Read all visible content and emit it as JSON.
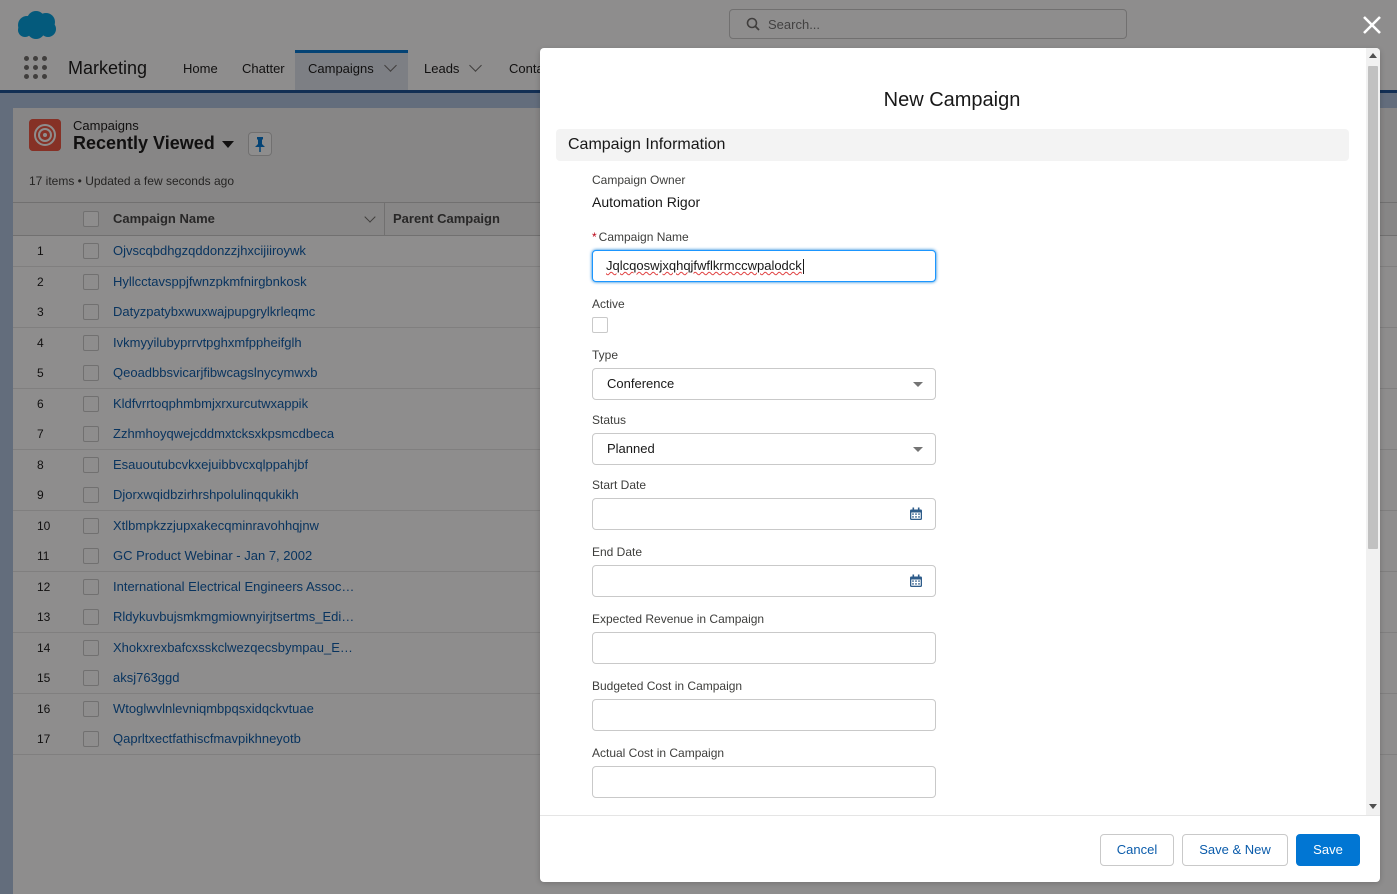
{
  "header": {
    "search_placeholder": "Search...",
    "app_name": "Marketing"
  },
  "nav": {
    "items": [
      {
        "label": "Home"
      },
      {
        "label": "Chatter"
      },
      {
        "label": "Campaigns"
      },
      {
        "label": "Leads"
      },
      {
        "label": "Conta"
      }
    ]
  },
  "list": {
    "object_label": "Campaigns",
    "view_name": "Recently Viewed",
    "meta": "17 items • Updated a few seconds ago",
    "columns": [
      "Campaign Name",
      "Parent Campaign"
    ],
    "rows": [
      {
        "num": "1",
        "name": "Ojvscqbdhgzqddonzzjhxcijiiroywk"
      },
      {
        "num": "2",
        "name": "Hyllcctavsppjfwnzpkmfnirgbnkosk"
      },
      {
        "num": "3",
        "name": "Datyzpatybxwuxwajpupgrylkrleqmc"
      },
      {
        "num": "4",
        "name": "Ivkmyyilubyprrvtpghxmfppheifglh"
      },
      {
        "num": "5",
        "name": "Qeoadbbsvicarjfibwcagslnycymwxb"
      },
      {
        "num": "6",
        "name": "Kldfvrrtoqphmbmjxrxurcutwxappik"
      },
      {
        "num": "7",
        "name": "Zzhmhoyqwejcddmxtcksxkpsmcdbeca"
      },
      {
        "num": "8",
        "name": "Esauoutubcvkxejuibbvcxqlppahjbf"
      },
      {
        "num": "9",
        "name": "Djorxwqidbzirhrshpolulinqqukikh"
      },
      {
        "num": "10",
        "name": "Xtlbmpkzzjupxakecqminravohhqjnw"
      },
      {
        "num": "11",
        "name": "GC Product Webinar - Jan 7, 2002"
      },
      {
        "num": "12",
        "name": "International Electrical Engineers Association"
      },
      {
        "num": "13",
        "name": "Rldykuvbujsmkmgmiownyirjtsertms_Edition"
      },
      {
        "num": "14",
        "name": "Xhokxrexbafcxsskclwezqecsbympau_Edition"
      },
      {
        "num": "15",
        "name": "aksj763ggd"
      },
      {
        "num": "16",
        "name": "Wtoglwvlnlevniqmbpqsxidqckvtuae"
      },
      {
        "num": "17",
        "name": "Qaprltxectfathiscfmavpikhneyotb"
      }
    ]
  },
  "modal": {
    "title": "New Campaign",
    "section_title": "Campaign Information",
    "owner_label": "Campaign Owner",
    "owner_value": "Automation Rigor",
    "name_required_mark": "*",
    "name_label": "Campaign Name",
    "name_value": "Jqlcqoswjxqhqjfwflkrmccwpalodck",
    "active_label": "Active",
    "type_label": "Type",
    "type_value": "Conference",
    "status_label": "Status",
    "status_value": "Planned",
    "start_date_label": "Start Date",
    "start_date_value": "",
    "end_date_label": "End Date",
    "end_date_value": "",
    "expected_revenue_label": "Expected Revenue in Campaign",
    "budgeted_cost_label": "Budgeted Cost in Campaign",
    "actual_cost_label": "Actual Cost in Campaign",
    "cancel_label": "Cancel",
    "save_new_label": "Save & New",
    "save_label": "Save"
  },
  "colors": {
    "brand": "#0176d3",
    "link": "#0b5cab",
    "campaign_icon": "#f15642",
    "required": "#ba0517"
  }
}
